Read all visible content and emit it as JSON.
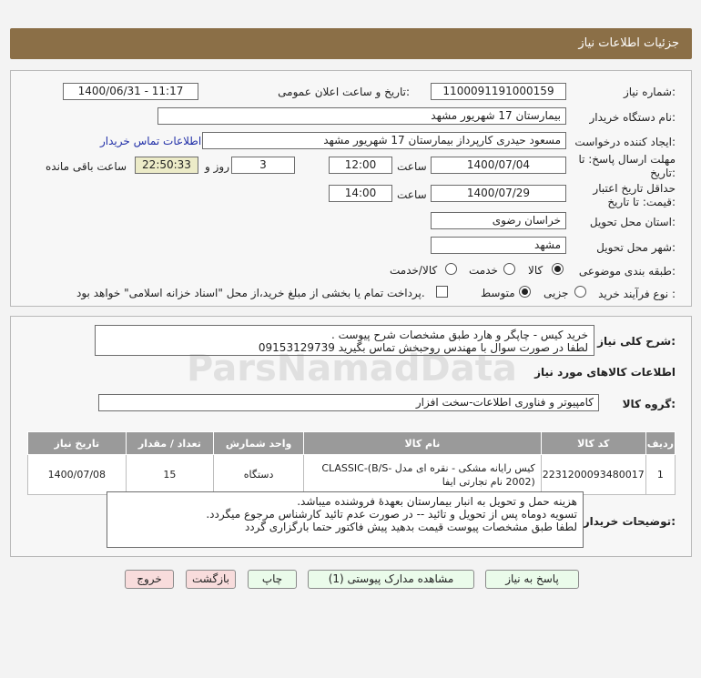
{
  "header": {
    "title": "جزئیات اطلاعات نیاز"
  },
  "fields": {
    "need_number_label": "شماره نیاز:",
    "need_number": "1100091191000159",
    "announce_label": "تاریخ و ساعت اعلان عمومی:",
    "announce_value": "1400/06/31 - 11:17",
    "buyer_org_label": "نام دستگاه خریدار:",
    "buyer_org": "بیمارستان 17 شهریور مشهد",
    "creator_label": "ایجاد کننده درخواست:",
    "creator": "مسعود حیدری کارپرداز بیمارستان 17 شهریور مشهد",
    "contact_link": "اطلاعات تماس خریدار",
    "deadline_label_1": "مهلت ارسال پاسخ: تا",
    "deadline_label_2": "تاریخ:",
    "deadline_date": "1400/07/04",
    "time_label": "ساعت",
    "deadline_time": "12:00",
    "days_value": "3",
    "days_label": "روز و",
    "remaining_time": "22:50:33",
    "remaining_label": "ساعت باقی مانده",
    "validity_label_1": "حداقل تاریخ اعتبار",
    "validity_label_2": "قیمت: تا تاریخ:",
    "validity_date": "1400/07/29",
    "validity_time_label": "ساعت",
    "validity_time": "14:00",
    "province_label": "استان محل تحویل:",
    "province": "خراسان رضوی",
    "city_label": "شهر محل تحویل:",
    "city": "مشهد",
    "category_label": "طبقه بندی موضوعی:",
    "category_options": [
      "کالا",
      "خدمت",
      "کالا/خدمت"
    ],
    "purchase_type_label": "نوع فرآیند خرید :",
    "purchase_options": [
      "جزیی",
      "متوسط"
    ],
    "payment_note": "پرداخت تمام یا بخشی از مبلغ خرید،از محل \"اسناد خزانه اسلامی\" خواهد بود."
  },
  "summary": {
    "label": "شرح کلی نیاز:",
    "line1": "خرید کیس - چاپگر و هارد طبق مشخصات شرح پیوست .",
    "line2": "لطفا در صورت سوال با مهندس روحبخش تماس بگیرید  09153129739"
  },
  "goods": {
    "section_title": "اطلاعات کالاهای مورد نیاز",
    "group_label": "گروه کالا:",
    "group_value": "کامپیوتر و فناوری اطلاعات-سخت افزار",
    "columns": [
      "ردیف",
      "کد کالا",
      "نام کالا",
      "واحد شمارش",
      "تعداد / مقدار",
      "تاریخ نیاز"
    ],
    "rows": [
      {
        "row": "1",
        "code": "2231200093480017",
        "name": "کیس رایانه مشکی - نقره ای مدل CLASSIC-(B/S-2002) نام تجارتی ایفا",
        "unit": "دستگاه",
        "qty": "15",
        "date": "1400/07/08"
      }
    ]
  },
  "notes": {
    "label": "توضیحات خریدار:",
    "line1": "هزینه حمل و تحویل به انبار بیمارستان بعهدهٔ فروشنده میباشد.",
    "line2": "تسویه دوماه پس از تحویل و تائید -- در صورت عدم تائید کارشناس مرجوع میگردد.",
    "line3": "لطفا طبق مشخصات پیوست قیمت بدهید پیش فاکتور حتما بارگزاری گردد"
  },
  "buttons": {
    "reply": "پاسخ به نیاز",
    "attachments": "مشاهده مدارک پیوستی (1)",
    "print": "چاپ",
    "back": "بازگشت",
    "exit": "خروج"
  },
  "watermark": {
    "main": "ParsNamadData"
  }
}
